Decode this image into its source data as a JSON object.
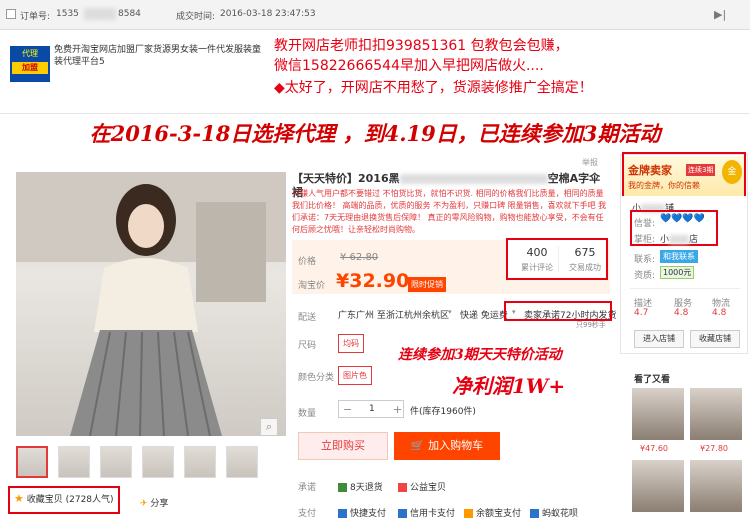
{
  "topbar": {
    "order_label": "订单号:",
    "order_prefix": "1535",
    "order_suffix": "8584",
    "time_label": "成交时间:",
    "time_value": "2016-03-18 23:47:53",
    "flag_icon": "flag-icon"
  },
  "agent": {
    "logo_line1": "代理",
    "logo_line2": "加盟",
    "desc": "免费开淘宝网店加盟厂家货源男女装一件代发服装童装代理平台5"
  },
  "teacher": {
    "line1": "教开网店老师扣扣939851361  包教包会包赚，",
    "line2": "微信15822666544早加入早把网店做火....",
    "line3": "◆太好了，开网店不用愁了，货源装修推广全搞定！"
  },
  "headline": "在2016-3-18日选择代理 ，到4.19日，已连续参加3期活动",
  "product": {
    "title_prefix": "【天天特价】2016黑",
    "title_suffix": "空棉A字伞裙",
    "report": "举报",
    "subdesc": "只赚人气用户都不要错过 不怕货比货，就怕不识货. 相同的价格我们比质量，相同的质量我们比价格！ 高端的品质，优质的服务 不为盈利，只赚口碑 限量销售，喜欢就下手吧 我们承诺：7天无理由退换货售后保障！ 真正的零风险购物，购物也能放心享受，不会有任何后顾之忧哦！让亲轻松时尚购物。",
    "price_label": "价格",
    "old_price": "¥ 62.80",
    "taobao_label": "淘宝价",
    "price": "¥32.90",
    "limit_badge": "限时促销",
    "reviews_num": "400",
    "reviews_label": "累计评论",
    "sold_num": "675",
    "sold_label": "交易成功",
    "ship_label": "配送",
    "ship_from": "广东广州 至",
    "ship_to": "浙江杭州余杭区",
    "ship_free": "快递 免运费",
    "seller_promise": "卖家承诺72小时内发货",
    "ship_time": "只99秒手",
    "size_label": "尺码",
    "size_value": "均码",
    "color_label": "颜色分类",
    "color_value": "图片色",
    "qty_label": "数量",
    "qty_minus": "−",
    "qty_value": "1",
    "qty_plus": "+",
    "stock": "件(库存1960件)",
    "buy_now": "立即购买",
    "add_cart": "加入购物车",
    "promise_label": "承诺",
    "promise_7day": "8天退货",
    "promise_charity": "公益宝贝",
    "pay_label": "支付",
    "pay_fast": "快捷支付",
    "pay_credit": "信用卡支付",
    "pay_balance": "余额宝支付",
    "pay_huabei": "蚂蚁花呗",
    "overlay1": "连续参加3期天天特价活动",
    "overlay2": "净利润1W+",
    "fav_label": "收藏宝贝 (2728人气)",
    "share_label": "分享"
  },
  "seller": {
    "gold_title": "金牌卖家",
    "gold_badge": "连续3期",
    "gold_sub": "我的金牌，你的信赖",
    "gold_medal": "金",
    "shop_name_prefix": "小",
    "shop_name_suffix": "铺",
    "credit_label": "信誉:",
    "credit_icons": "💙💙💙💙",
    "keeper_label": "掌柜:",
    "keeper_prefix": "小",
    "keeper_suffix": "店",
    "contact_label": "联系:",
    "contact_value": "和我联系",
    "qual_label": "资质:",
    "qual_value": "1000元",
    "desc_label": "描述",
    "desc_score": "4.7",
    "service_label": "服务",
    "service_score": "4.8",
    "logistics_label": "物流",
    "logistics_score": "4.8",
    "enter_shop": "进入店铺",
    "fav_shop": "收藏店铺"
  },
  "looked": {
    "title": "看了又看",
    "prices": [
      "¥47.60",
      "¥27.80",
      "",
      ""
    ]
  },
  "colors": {
    "red": "#e60012",
    "orange": "#ff4400"
  }
}
